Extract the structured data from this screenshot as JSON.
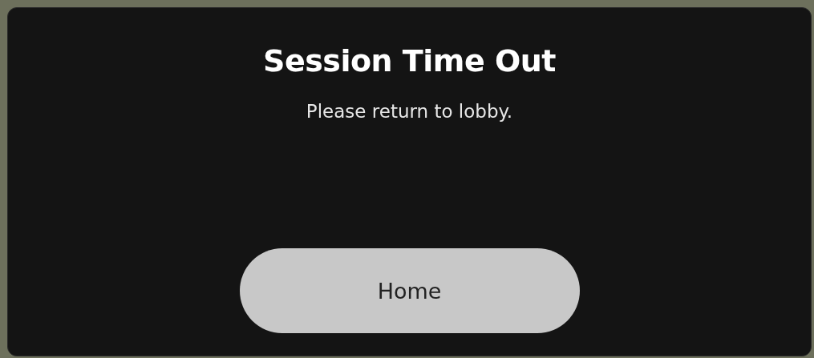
{
  "dialog": {
    "title": "Session Time Out",
    "message": "Please return to lobby.",
    "buttons": [
      "Home"
    ]
  }
}
